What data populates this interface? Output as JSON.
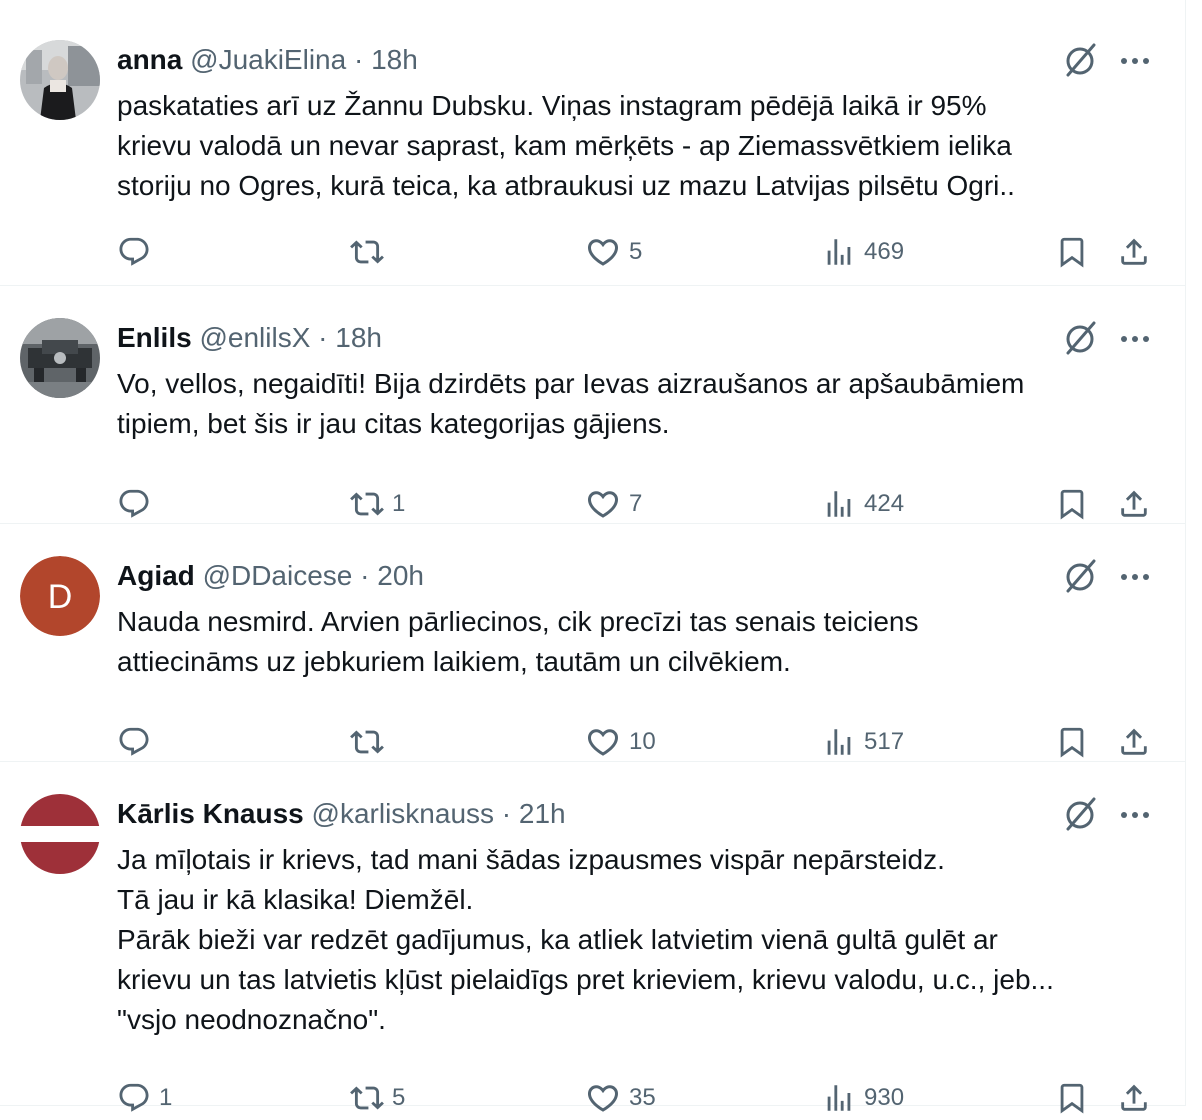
{
  "colors": {
    "text_primary": "#0f1419",
    "text_secondary": "#536471",
    "divider": "#eff3f4",
    "avatar_agiad": "#b2462c",
    "latvian_carmine": "#9e3039"
  },
  "tweets": [
    {
      "name": "anna",
      "handle": "@JuakiElina",
      "separator": "·",
      "time": "18h",
      "avatar": "photo",
      "lines": [
        "paskataties arī uz Žannu Dubsku. Viņas instagram pēdējā laikā ir 95%",
        "krievu valodā un nevar saprast, kam mērķēts - ap Ziemassvētkiem ielika",
        "storiju no Ogres, kurā teica, ka atbraukusi uz mazu Latvijas pilsētu Ogri.."
      ],
      "replies": "",
      "reposts": "",
      "likes": "5",
      "views": "469"
    },
    {
      "name": "Enlils",
      "handle": "@enlilsX",
      "separator": "·",
      "time": "18h",
      "avatar": "photo",
      "lines": [
        "Vo, vellos, negaidīti! Bija dzirdēts par Ievas aizraušanos ar apšaubāmiem",
        "tipiem, bet šis ir jau citas kategorijas gājiens."
      ],
      "replies": "",
      "reposts": "1",
      "likes": "7",
      "views": "424"
    },
    {
      "name": "Agiad",
      "handle": "@DDaicese",
      "separator": "·",
      "time": "20h",
      "avatar": "letter",
      "avatar_letter": "D",
      "lines": [
        "Nauda nesmird. Arvien pārliecinos, cik precīzi tas senais teiciens",
        "attiecināms uz jebkuriem laikiem, tautām un cilvēkiem."
      ],
      "replies": "",
      "reposts": "",
      "likes": "10",
      "views": "517"
    },
    {
      "name": "Kārlis Knauss",
      "handle": "@karlisknauss",
      "separator": "·",
      "time": "21h",
      "avatar": "flag",
      "lines": [
        "Ja mīļotais ir krievs, tad mani šādas izpausmes vispār nepārsteidz.",
        "Tā jau ir kā klasika! Diemžēl.",
        "Pārāk bieži var redzēt gadījumus, ka atliek latvietim vienā gultā gulēt ar",
        "krievu un tas latvietis kļūst pielaidīgs pret krieviem, krievu valodu, u.c., jeb...",
        "\"vsjo neodnoznačno\"."
      ],
      "replies": "1",
      "reposts": "5",
      "likes": "35",
      "views": "930"
    }
  ]
}
